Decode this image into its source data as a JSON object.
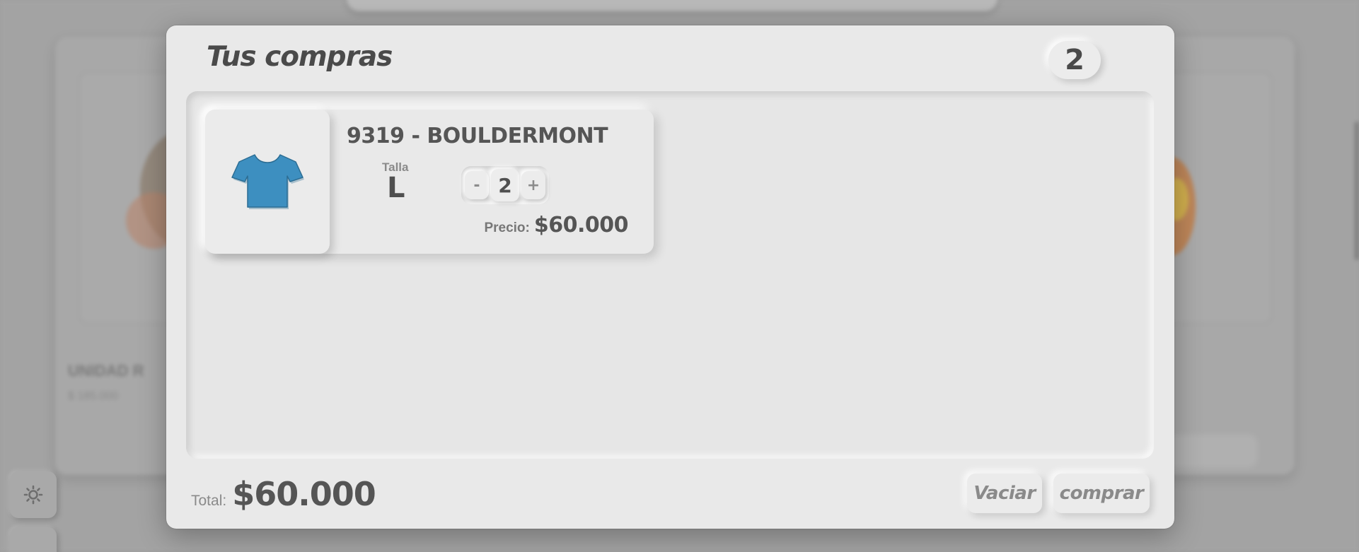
{
  "background": {
    "product_name_partial": "UNIDAD R",
    "product_price_partial": "$ 185.000"
  },
  "cart": {
    "title": "Tus compras",
    "item_count": "2",
    "items": [
      {
        "name": "9319 - BOULDERMONT",
        "size_label": "Talla",
        "size_value": "L",
        "decrement_symbol": "-",
        "quantity": "2",
        "increment_symbol": "+",
        "price_label": "Precio:",
        "price": "$60.000",
        "image_icon": "tshirt-icon",
        "image_color": "#3d8fc0"
      }
    ],
    "total_label": "Total:",
    "total_value": "$60.000",
    "empty_button_label": "Vaciar",
    "buy_button_label": "comprar"
  },
  "sidebar_buttons": [
    {
      "icon": "sun-icon"
    },
    {
      "icon": "cart-icon"
    }
  ],
  "colors": {
    "modal_background": "#e9e9e9",
    "text_dark": "#4a4a4a",
    "text_muted": "#8a8a8a",
    "overlay": "#a3a3a3"
  }
}
